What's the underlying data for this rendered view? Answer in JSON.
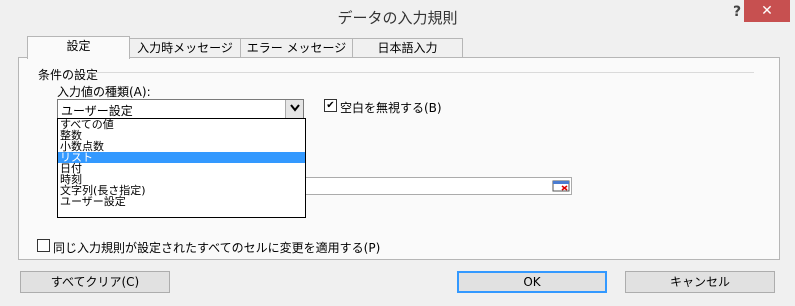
{
  "window": {
    "title": "データの入力規則",
    "help": "?",
    "close": "✕"
  },
  "tabs": [
    "設定",
    "入力時メッセージ",
    "エラー メッセージ",
    "日本語入力"
  ],
  "conditions": {
    "group_label": "条件の設定",
    "type_label": "入力値の種類(A):",
    "selected_value": "ユーザー設定",
    "options": [
      "すべての値",
      "整数",
      "小数点数",
      "リスト",
      "日付",
      "時刻",
      "文字列(長さ指定)",
      "ユーザー設定"
    ],
    "highlighted_option": "リスト",
    "ignore_blank_label": "空白を無視する(B)",
    "ignore_blank_checked": true
  },
  "apply_all_label": "同じ入力規則が設定されたすべてのセルに変更を適用する(P)",
  "apply_all_checked": false,
  "buttons": {
    "clear": "すべてクリア(C)",
    "ok": "OK",
    "cancel": "キャンセル"
  },
  "icons": {
    "dropdown": "chevron-down-icon",
    "range_select": "range-select-icon",
    "check": "checkmark-icon"
  }
}
